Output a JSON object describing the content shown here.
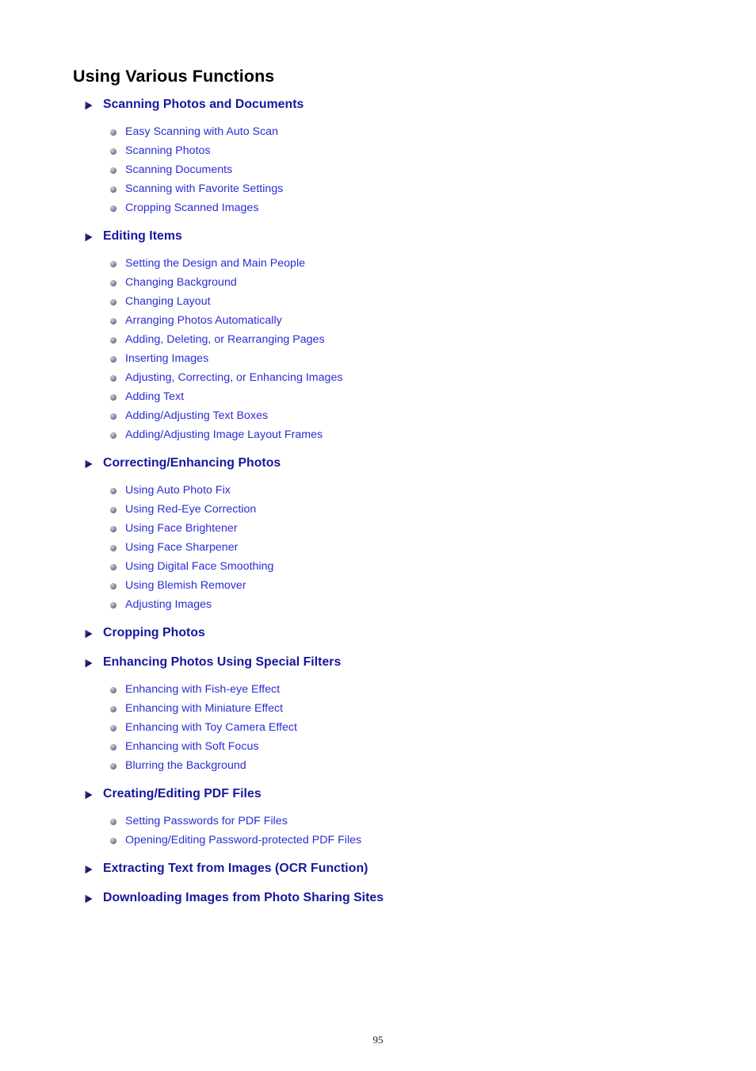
{
  "document": {
    "title": "Using Various Functions",
    "page_number": "95"
  },
  "colors": {
    "heading_link": "#16179C",
    "sub_link": "#2C2CD4",
    "title": "#000000",
    "arrow_marker": "#1A1A6E",
    "bullet_marker": "#6E7285",
    "background": "#FFFFFF"
  },
  "sections": [
    {
      "heading": "Scanning Photos and Documents",
      "items": [
        "Easy Scanning with Auto Scan",
        "Scanning Photos",
        "Scanning Documents",
        "Scanning with Favorite Settings",
        "Cropping Scanned Images"
      ]
    },
    {
      "heading": "Editing Items",
      "items": [
        "Setting the Design and Main People",
        "Changing Background",
        "Changing Layout",
        "Arranging Photos Automatically",
        "Adding, Deleting, or Rearranging Pages",
        "Inserting Images",
        "Adjusting, Correcting, or Enhancing Images",
        "Adding Text",
        "Adding/Adjusting Text Boxes",
        "Adding/Adjusting Image Layout Frames"
      ]
    },
    {
      "heading": "Correcting/Enhancing Photos",
      "items": [
        "Using Auto Photo Fix",
        "Using Red-Eye Correction",
        "Using Face Brightener",
        "Using Face Sharpener",
        "Using Digital Face Smoothing",
        "Using Blemish Remover",
        "Adjusting Images"
      ]
    },
    {
      "heading": "Cropping Photos",
      "items": []
    },
    {
      "heading": "Enhancing Photos Using Special Filters",
      "items": [
        "Enhancing with Fish-eye Effect",
        "Enhancing with Miniature Effect",
        "Enhancing with Toy Camera Effect",
        "Enhancing with Soft Focus",
        "Blurring the Background"
      ]
    },
    {
      "heading": "Creating/Editing PDF Files",
      "items": [
        "Setting Passwords for PDF Files",
        "Opening/Editing Password-protected PDF Files"
      ]
    },
    {
      "heading": "Extracting Text from Images (OCR Function)",
      "items": []
    },
    {
      "heading": "Downloading Images from Photo Sharing Sites",
      "items": []
    }
  ]
}
